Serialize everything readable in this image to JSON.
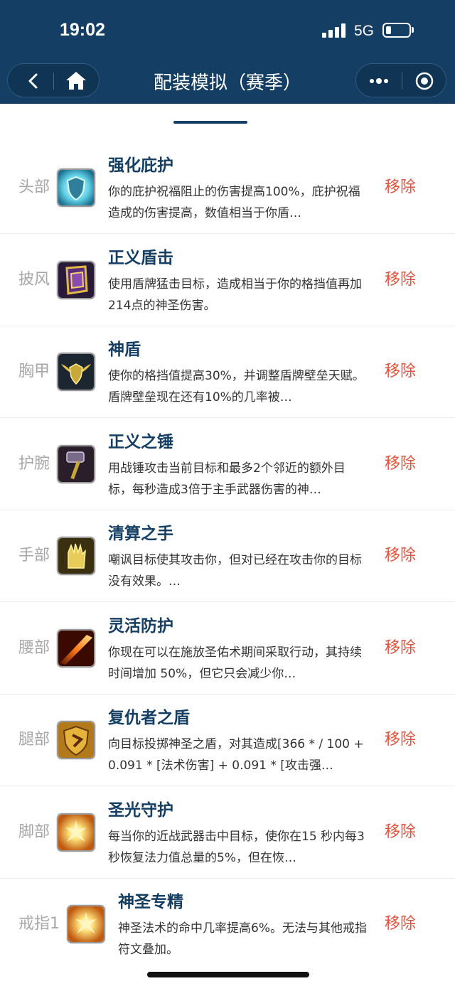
{
  "status": {
    "time": "19:02",
    "network": "5G"
  },
  "nav": {
    "title": "配装模拟（赛季）"
  },
  "theme": {
    "primary": "#143e63",
    "remove": "#e0533d"
  },
  "remove_label": "移除",
  "items": [
    {
      "slot": "头部",
      "name": "强化庇护",
      "desc": "你的庇护祝福阻止的伤害提高100%，庇护祝福造成的伤害提高，数值相当于你盾…",
      "icon": "shield-glow-icon"
    },
    {
      "slot": "披风",
      "name": "正义盾击",
      "desc": "使用盾牌猛击目标，造成相当于你的格挡值再加214点的神圣伤害。",
      "icon": "shield-slam-icon"
    },
    {
      "slot": "胸甲",
      "name": "神盾",
      "desc": "使你的格挡值提高30%，并调整盾牌壁垒天赋。盾牌壁垒现在还有10%的几率被…",
      "icon": "winged-shield-icon"
    },
    {
      "slot": "护腕",
      "name": "正义之锤",
      "desc": "用战锤攻击当前目标和最多2个邻近的额外目标，每秒造成3倍于主手武器伤害的神…",
      "icon": "hammer-icon"
    },
    {
      "slot": "手部",
      "name": "清算之手",
      "desc": "嘲讽目标使其攻击你，但对已经在攻击你的目标没有效果。…",
      "icon": "hand-of-reckoning-icon"
    },
    {
      "slot": "腰部",
      "name": "灵活防护",
      "desc": "你现在可以在施放圣佑术期间采取行动，其持续时间增加 50%，但它只会减少你…",
      "icon": "fire-streak-icon"
    },
    {
      "slot": "腿部",
      "name": "复仇者之盾",
      "desc": "向目标投掷神圣之盾，对其造成[366 * / 100 + 0.091 * [法术伤害] + 0.091 * [攻击强…",
      "icon": "avengers-shield-icon"
    },
    {
      "slot": "脚部",
      "name": "圣光守护",
      "desc": "每当你的近战武器击中目标，使你在15 秒内每3秒恢复法力值总量的5%，但在恢…",
      "icon": "holy-burst-icon"
    },
    {
      "slot": "戒指1",
      "name": "神圣专精",
      "desc": "神圣法术的命中几率提高6%。无法与其他戒指符文叠加。",
      "icon": "holy-burst-icon"
    }
  ]
}
